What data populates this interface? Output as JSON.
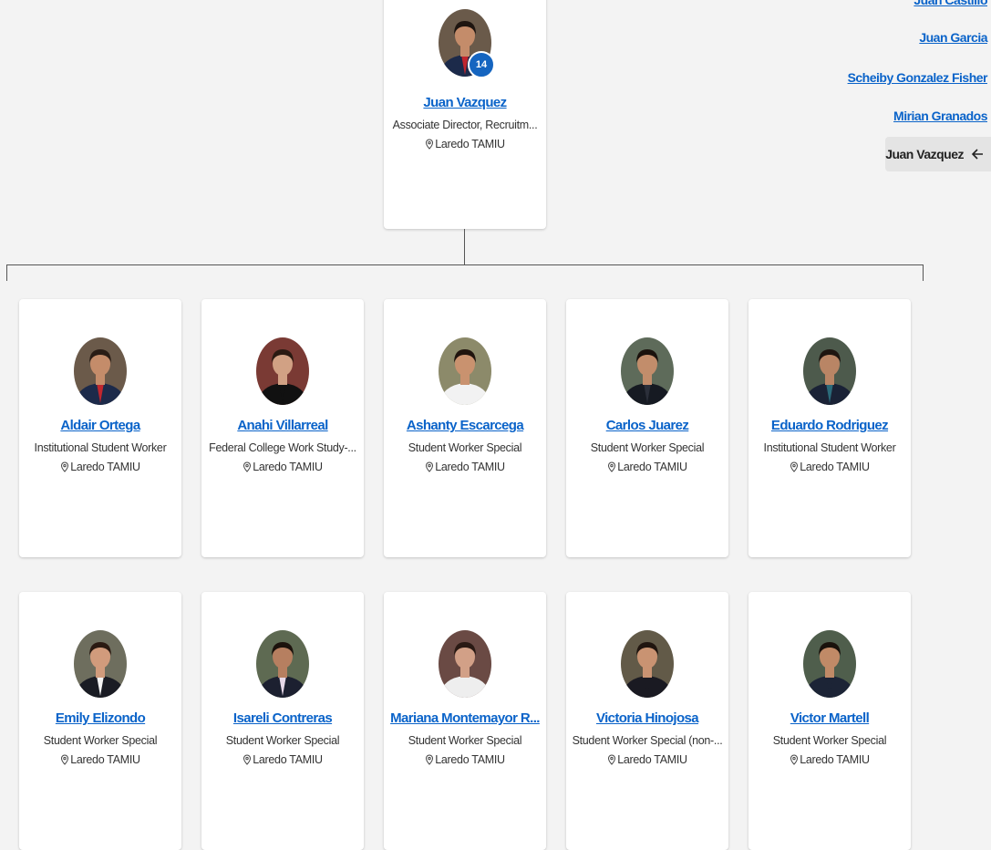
{
  "manager": {
    "name": "Juan Vazquez",
    "title": "Associate Director, Recruitm...",
    "location": "Laredo TAMIU",
    "reports_count": "14",
    "icon": "avatar-photo"
  },
  "breadcrumbs": {
    "items": [
      "Juan Castillo",
      "Juan Garcia",
      "Scheiby Gonzalez Fisher",
      "Mirian Granados"
    ],
    "current": "Juan Vazquez",
    "current_icon": "arrow-left-icon"
  },
  "reports": [
    {
      "name": "Aldair Ortega",
      "title": "Institutional Student Worker",
      "location": "Laredo TAMIU",
      "shirt": "#1c2a4a",
      "tie": "#c0262e",
      "hair": "#2a1d16",
      "skin": "#c48c6a",
      "bg": "#6b5a4a"
    },
    {
      "name": "Anahi Villarreal",
      "title": "Federal College Work Study-...",
      "location": "Laredo TAMIU",
      "shirt": "#111111",
      "tie": "#111111",
      "hair": "#2a1a12",
      "skin": "#d1a184",
      "bg": "#7a3a34"
    },
    {
      "name": "Ashanty Escarcega",
      "title": "Student Worker Special",
      "location": "Laredo TAMIU",
      "shirt": "#f2f2f2",
      "tie": "#f2f2f2",
      "hair": "#20140e",
      "skin": "#c9926f",
      "bg": "#8c8a6a"
    },
    {
      "name": "Carlos Juarez",
      "title": "Student Worker Special",
      "location": "Laredo TAMIU",
      "shirt": "#161a22",
      "tie": "#2b2f3a",
      "hair": "#1a120d",
      "skin": "#c28d6b",
      "bg": "#5e6b5a"
    },
    {
      "name": "Eduardo Rodriguez",
      "title": "Institutional Student Worker",
      "location": "Laredo TAMIU",
      "shirt": "#1a2236",
      "tie": "#2b6a7a",
      "hair": "#1e1510",
      "skin": "#b98565",
      "bg": "#4d5a4c"
    },
    {
      "name": "Emily Elizondo",
      "title": "Student Worker Special",
      "location": "Laredo TAMIU",
      "shirt": "#1a1c24",
      "tie": "#f4f4f4",
      "hair": "#2b1a12",
      "skin": "#d19b7c",
      "bg": "#6e6e5e"
    },
    {
      "name": "Isareli Contreras",
      "title": "Student Worker Special",
      "location": "Laredo TAMIU",
      "shirt": "#1c2030",
      "tie": "#e6d8e8",
      "hair": "#1c120c",
      "skin": "#b67f60",
      "bg": "#5e6a52"
    },
    {
      "name": "Mariana Montemayor R...",
      "title": "Student Worker Special",
      "location": "Laredo TAMIU",
      "shirt": "#eeeeee",
      "tie": "#eeeeee",
      "hair": "#2a1a14",
      "skin": "#d2a087",
      "bg": "#6a4a44"
    },
    {
      "name": "Victoria Hinojosa",
      "title": "Student Worker Special (non-...",
      "location": "Laredo TAMIU",
      "shirt": "#1a1a22",
      "tie": "#1a1a22",
      "hair": "#20150f",
      "skin": "#c99372",
      "bg": "#625a48"
    },
    {
      "name": "Victor Martell",
      "title": "Student Worker Special",
      "location": "Laredo TAMIU",
      "shirt": "#1c2436",
      "tie": "#1c2436",
      "hair": "#1a120c",
      "skin": "#c08a67",
      "bg": "#4f5e4c"
    }
  ]
}
